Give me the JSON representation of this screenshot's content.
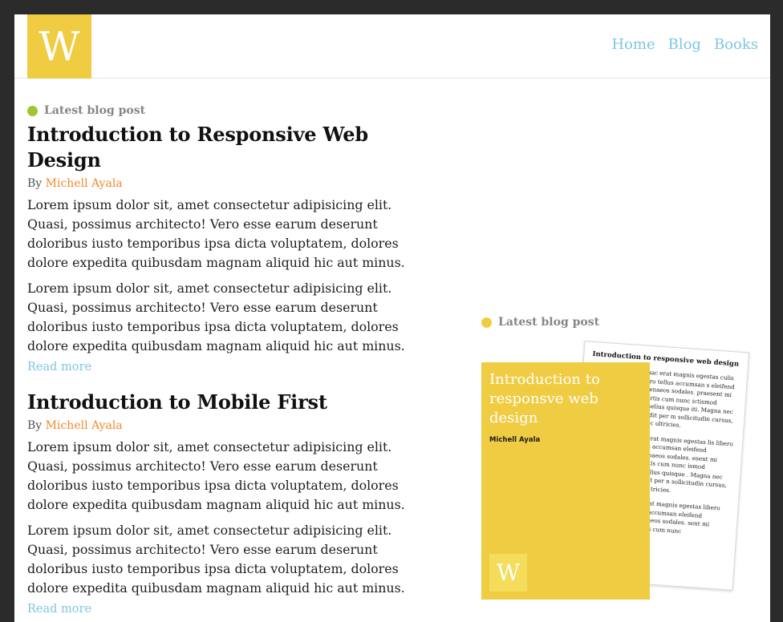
{
  "header": {
    "logo_letter": "W",
    "nav": [
      "Home",
      "Blog",
      "Books"
    ]
  },
  "colors": {
    "accent_yellow": "#f0cc43",
    "link_blue": "#7cc6e5",
    "author_orange": "#f08a2a",
    "dot_green": "#a0c534"
  },
  "posts": [
    {
      "eyebrow": "Latest blog post",
      "title": "Introduction to Responsive Web Design",
      "by": "By",
      "author": "Michell Ayala",
      "paragraphs": [
        "Lorem ipsum dolor sit, amet consectetur adipisicing elit. Quasi, possimus architecto! Vero esse earum deserunt doloribus iusto temporibus ipsa dicta voluptatem, dolores dolore expedita quibusdam magnam aliquid hic aut minus.",
        "Lorem ipsum dolor sit, amet consectetur adipisicing elit. Quasi, possimus architecto! Vero esse earum deserunt doloribus iusto temporibus ipsa dicta voluptatem, dolores dolore expedita quibusdam magnam aliquid hic aut minus."
      ],
      "read_more": "Read more"
    },
    {
      "title": "Introduction to Mobile First",
      "by": "By",
      "author": "Michell Ayala",
      "paragraphs": [
        "Lorem ipsum dolor sit, amet consectetur adipisicing elit. Quasi, possimus architecto! Vero esse earum deserunt doloribus iusto temporibus ipsa dicta voluptatem, dolores dolore expedita quibusdam magnam aliquid hic aut minus.",
        "Lorem ipsum dolor sit, amet consectetur adipisicing elit. Quasi, possimus architecto! Vero esse earum deserunt doloribus iusto temporibus ipsa dicta voluptatem, dolores dolore expedita quibusdam magnam aliquid hic aut minus."
      ],
      "read_more": "Read more"
    }
  ],
  "aside": {
    "eyebrow": "Latest blog post",
    "book": {
      "cover_title": "Introduction to responsve web design",
      "cover_author": "Michell Ayala",
      "cover_logo": "W",
      "paper_title": "Introduction to responsive web design",
      "paper_text_1": "or hac erat magnis egestas culis libero tellus accumsan s eleifend himenaeos sodales. praesent mi lobortis cum nunc ictismod phaselius quisque iti. Magna nec blandit per m sollicitudin cursus, donec ultricies.",
      "paper_text_2": "hac erat magnis egestas lis libero tellus accumsan eleifend himenaeos sodales. esent mi lobortis cum nunc ismod phaselius quisque . Magna nec blandit per n sollicitudin cursus, donec tricies.",
      "paper_text_3": "hac erat magnis egestas libero tellus accumsan eleifend himenaeos sodales. sent mi lobortis cum nunc"
    }
  }
}
